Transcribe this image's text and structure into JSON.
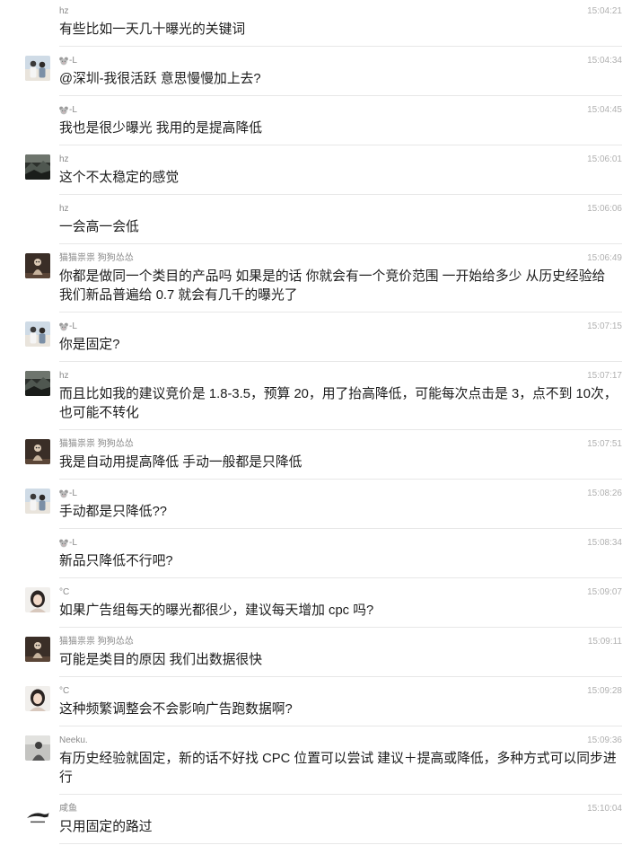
{
  "colors": {
    "background": "#ffffff",
    "sender_name": "#8a8a8a",
    "timestamp": "#b0b0b0",
    "message_text": "#1b1b1b",
    "divider": "#e7e7e7"
  },
  "messages": [
    {
      "sender": "hz",
      "time": "15:04:21",
      "lines": [
        "有些比如一天几十曝光的关键词"
      ]
    },
    {
      "sender": "-L",
      "name_icon": "mouse-face-icon",
      "time": "15:04:34",
      "avatar": "two-people-photo",
      "lines": [
        "@深圳-我很活跃 意思慢慢加上去?"
      ]
    },
    {
      "sender": "-L",
      "name_icon": "mouse-face-icon",
      "time": "15:04:45",
      "lines": [
        "我也是很少曝光 我用的是提高降低"
      ]
    },
    {
      "sender": "hz",
      "time": "15:06:01",
      "avatar": "dark-landscape-photo",
      "lines": [
        "这个不太稳定的感觉"
      ]
    },
    {
      "sender": "hz",
      "time": "15:06:06",
      "lines": [
        "一会高一会低"
      ]
    },
    {
      "sender": "猫猫祟祟 狗狗怂怂",
      "time": "15:06:49",
      "avatar": "figurine-photo",
      "lines": [
        "你都是做同一个类目的产品吗 如果是的话 你就会有一个竞价范围 一开始给多少 从历史经验给",
        "我们新品普遍给 0.7 就会有几千的曝光了"
      ]
    },
    {
      "sender": "-L",
      "name_icon": "mouse-face-icon",
      "time": "15:07:15",
      "avatar": "two-people-photo",
      "lines": [
        "你是固定?"
      ]
    },
    {
      "sender": "hz",
      "time": "15:07:17",
      "avatar": "dark-landscape-photo",
      "lines": [
        "而且比如我的建议竞价是 1.8-3.5，预算 20，用了抬高降低，可能每次点击是 3，点不到 10次，",
        "也可能不转化"
      ]
    },
    {
      "sender": "猫猫祟祟 狗狗怂怂",
      "time": "15:07:51",
      "avatar": "figurine-photo",
      "lines": [
        "我是自动用提高降低 手动一般都是只降低"
      ]
    },
    {
      "sender": "-L",
      "name_icon": "mouse-face-icon",
      "time": "15:08:26",
      "avatar": "two-people-photo",
      "lines": [
        "手动都是只降低??"
      ]
    },
    {
      "sender": "-L",
      "name_icon": "mouse-face-icon",
      "time": "15:08:34",
      "lines": [
        "新品只降低不行吧?"
      ]
    },
    {
      "sender": "°C",
      "time": "15:09:07",
      "avatar": "girl-portrait-photo",
      "lines": [
        "如果广告组每天的曝光都很少，建议每天增加 cpc 吗?"
      ]
    },
    {
      "sender": "猫猫祟祟 狗狗怂怂",
      "time": "15:09:11",
      "avatar": "figurine-photo",
      "lines": [
        "可能是类目的原因 我们出数据很快"
      ]
    },
    {
      "sender": "°C",
      "time": "15:09:28",
      "avatar": "girl-portrait-photo",
      "lines": [
        "这种频繁调整会不会影响广告跑数据啊?"
      ]
    },
    {
      "sender": "Neeku.",
      "time": "15:09:36",
      "avatar": "gray-portrait-photo",
      "lines": [
        "有历史经验就固定，新的话不好找 CPC 位置可以尝试 建议＋提高或降低，多种方式可以同步进",
        "行"
      ]
    },
    {
      "sender": "咸鱼",
      "time": "15:10:04",
      "avatar": "fish-logo",
      "lines": [
        "只用固定的路过"
      ]
    }
  ]
}
